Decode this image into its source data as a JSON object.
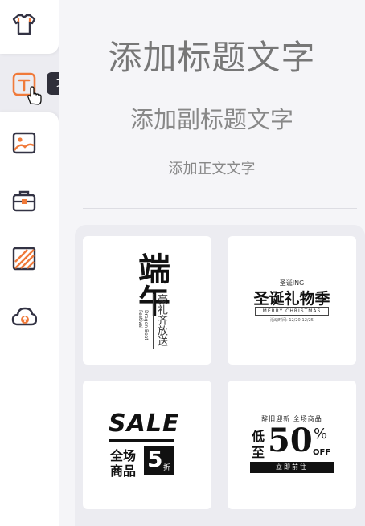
{
  "sidebar": {
    "items": [
      {
        "name": "tshirt-icon",
        "label": ""
      },
      {
        "name": "text-icon",
        "label": "文本"
      },
      {
        "name": "image-icon",
        "label": ""
      },
      {
        "name": "toolbox-icon",
        "label": ""
      },
      {
        "name": "background-icon",
        "label": ""
      },
      {
        "name": "cloud-upload-icon",
        "label": ""
      }
    ],
    "tooltip": "文本"
  },
  "colors": {
    "accent": "#f07a3a",
    "dark": "#333344"
  },
  "main": {
    "heading": "添加标题文字",
    "subheading": "添加副标题文字",
    "body": "添加正文文字"
  },
  "templates": [
    {
      "id": "duanwu",
      "big": "端午",
      "side": "豪礼齐放送",
      "en": "Dragon Boat Festival"
    },
    {
      "id": "christmas",
      "top": "圣诞ING",
      "big": "圣诞礼物季",
      "en": "MERRY CHRISTMAS",
      "date": "活动时间: 12/20-12/25"
    },
    {
      "id": "sale",
      "big": "SALE",
      "line1": "全场",
      "line2": "商品",
      "num": "5",
      "zhe": "折"
    },
    {
      "id": "discount",
      "top": "辞旧迎新  全场商品",
      "left1": "低",
      "left2": "至",
      "num": "50",
      "pct": "%",
      "off": "OFF",
      "btn": "立即前往"
    }
  ]
}
